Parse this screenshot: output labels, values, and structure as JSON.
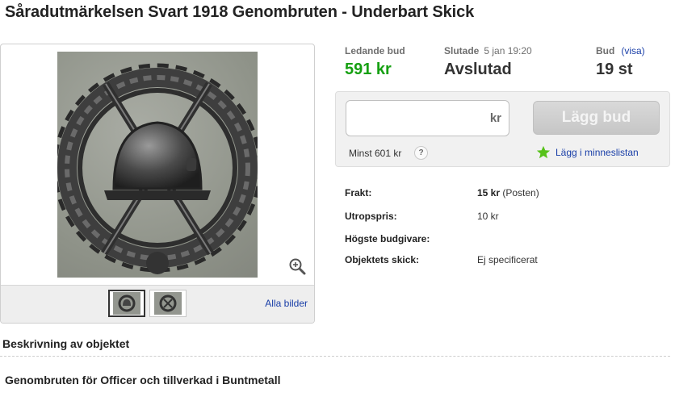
{
  "listing": {
    "title": "Såradutmärkelsen Svart 1918 Genombruten - Underbart Skick"
  },
  "gallery": {
    "main_image_alt": "Såradutmärkelsen svart 1918 genombruten",
    "all_images_label": "Alla bilder",
    "thumbnail_count": 2
  },
  "stats": {
    "leading_bid_label": "Ledande bud",
    "leading_bid_value": "591 kr",
    "ended_label": "Slutade",
    "ended_date": "5 jan 19:20",
    "ended_value": "Avslutad",
    "bids_label": "Bud",
    "bids_link": "(visa)",
    "bids_value": "19 st"
  },
  "bid_form": {
    "input_value": "",
    "currency": "kr",
    "button_label": "Lägg bud",
    "min_bid": "Minst 601 kr",
    "help": "?",
    "watchlist_label": "Lägg i minneslistan"
  },
  "details": {
    "rows": [
      {
        "label": "Frakt:",
        "value_bold": "15 kr",
        "value": " (Posten)"
      },
      {
        "label": "Utropspris:",
        "value_bold": "",
        "value": "10 kr"
      },
      {
        "label": "Högste budgivare:",
        "value_bold": "",
        "value": ""
      },
      {
        "label": "Objektets skick:",
        "value_bold": "",
        "value": "Ej specificerat"
      }
    ]
  },
  "description": {
    "heading": "Beskrivning av objektet",
    "text": "Genombruten för Officer och tillverkad i Buntmetall"
  },
  "colors": {
    "price_green": "#16a012",
    "link_blue": "#1a3fa8",
    "star_green": "#57c21a"
  }
}
